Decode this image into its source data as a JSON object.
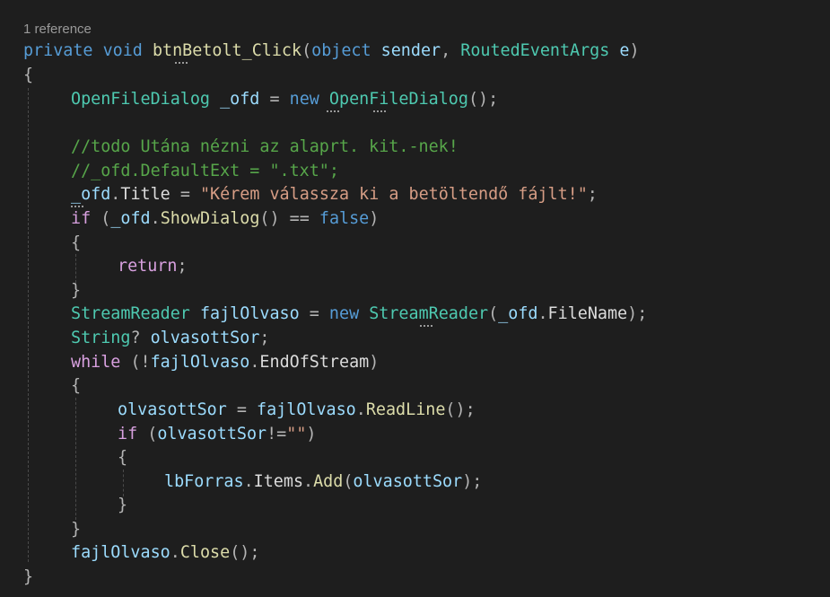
{
  "codelens": "1 reference",
  "code": {
    "signature": {
      "mod": "private",
      "ret": "void",
      "name": "btnBetolt_Click",
      "p1type": "object",
      "p1name": "sender",
      "p2type": "RoutedEventArgs",
      "p2name": "e"
    },
    "line3": {
      "type": "OpenFileDialog",
      "var": "_ofd",
      "new": "new",
      "ctor": "OpenFileDialog"
    },
    "comment1": "//todo Utána nézni az alaprt. kit.-nek!",
    "comment2": "//_ofd.DefaultExt = \".txt\";",
    "line7": {
      "obj": "_ofd",
      "prop": "Title",
      "str": "\"Kérem válassza ki a betöltendő fájlt!\""
    },
    "line8": {
      "kw": "if",
      "obj": "_ofd",
      "method": "ShowDialog",
      "val": "false"
    },
    "line10": "return",
    "line12": {
      "type": "StreamReader",
      "var": "fajlOlvaso",
      "new": "new",
      "ctor": "StreamReader",
      "obj": "_ofd",
      "prop": "FileName"
    },
    "line13": {
      "type": "String",
      "var": "olvasottSor"
    },
    "line14": {
      "kw": "while",
      "obj": "fajlOlvaso",
      "prop": "EndOfStream"
    },
    "line16": {
      "var": "olvasottSor",
      "obj": "fajlOlvaso",
      "method": "ReadLine"
    },
    "line17": {
      "kw": "if",
      "var": "olvasottSor",
      "str": "\"\""
    },
    "line19": {
      "obj": "lbForras",
      "prop": "Items",
      "method": "Add",
      "arg": "olvasottSor"
    },
    "line22": {
      "obj": "fajlOlvaso",
      "method": "Close"
    }
  }
}
